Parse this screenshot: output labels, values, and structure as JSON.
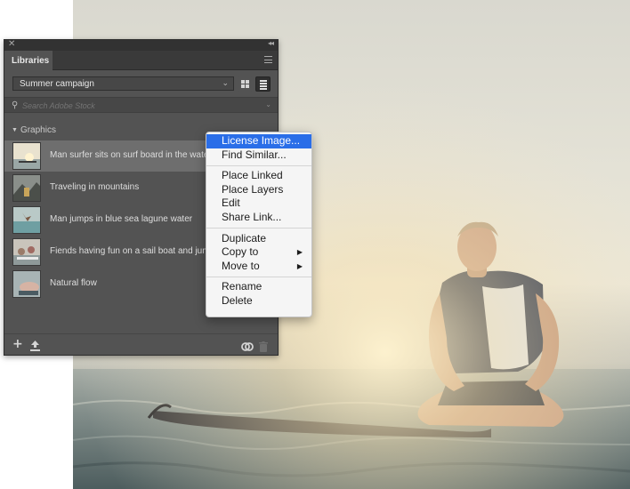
{
  "panel": {
    "tab_label": "Libraries",
    "library_select": "Summer campaign",
    "search_placeholder": "Search Adobe Stock",
    "section_title": "Graphics",
    "items": [
      {
        "label": "Man surfer sits on surf board in the water and"
      },
      {
        "label": "Traveling in mountains"
      },
      {
        "label": "Man jumps in blue sea lagune water"
      },
      {
        "label": "Fiends having fun on a sail boat and jump in"
      },
      {
        "label": "Natural flow"
      }
    ],
    "selected_index": 0,
    "icons": {
      "close": "close-icon",
      "collapse": "collapse-icon",
      "menu": "panel-menu-icon",
      "grid_view": "grid-view-icon",
      "list_view": "list-view-icon",
      "search": "search-icon",
      "add": "add-icon",
      "upload": "upload-icon",
      "sync": "creative-cloud-sync-icon",
      "trash": "trash-icon"
    }
  },
  "context_menu": {
    "groups": [
      [
        "License Image...",
        "Find Similar..."
      ],
      [
        "Place Linked",
        "Place Layers",
        "Edit",
        "Share Link..."
      ],
      [
        "Duplicate",
        "Copy to",
        "Move to"
      ],
      [
        "Rename",
        "Delete"
      ]
    ],
    "highlighted": "License Image...",
    "submenu_items": [
      "Copy to",
      "Move to"
    ],
    "highlight_color": "#2a6ee8"
  },
  "colors": {
    "panel_bg": "#535353",
    "selected_row": "#6e6e6e",
    "menu_bg": "#f5f5f5"
  }
}
